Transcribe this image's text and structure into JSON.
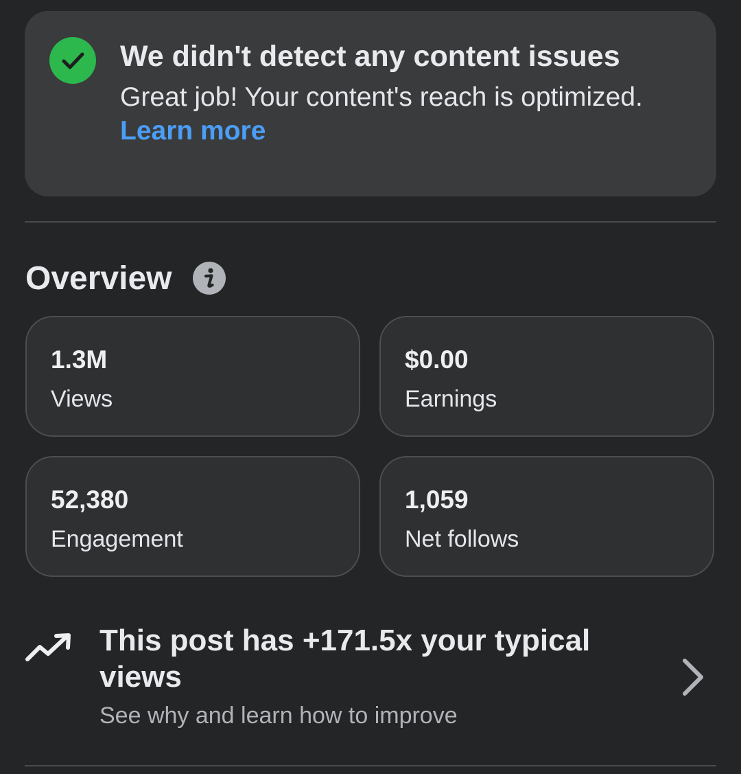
{
  "status_banner": {
    "title": "We didn't detect any content issues",
    "description": "Great job! Your content's reach is optimized.",
    "link_label": "Learn more",
    "icon": "check-circle-icon",
    "accent_color": "#2db84d",
    "link_color": "#4b9ef5"
  },
  "overview": {
    "title": "Overview",
    "info_icon": "info-icon",
    "metrics": [
      {
        "value": "1.3M",
        "label": "Views"
      },
      {
        "value": "$0.00",
        "label": "Earnings"
      },
      {
        "value": "52,380",
        "label": "Engagement"
      },
      {
        "value": "1,059",
        "label": "Net follows"
      }
    ]
  },
  "insight": {
    "icon": "trending-up-icon",
    "title": "This post has +171.5x your typical views",
    "subtitle": "See why and learn how to improve",
    "action_icon": "chevron-right-icon"
  }
}
